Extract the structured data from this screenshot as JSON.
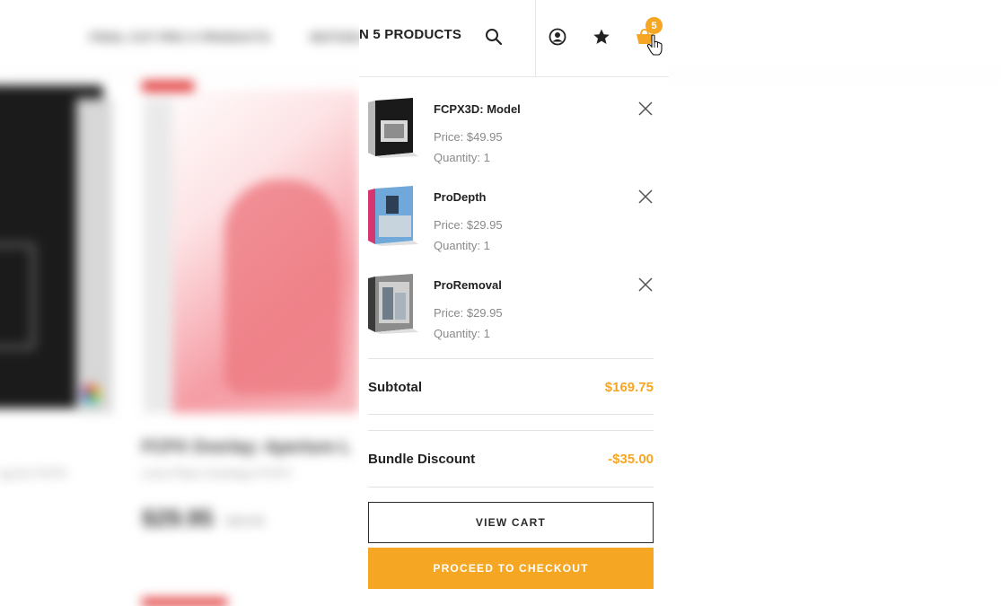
{
  "background": {
    "nav_items": [
      "FINAL CUT PRO X PRODUCTS",
      "MOTION 5 PRODUCTS"
    ],
    "product_title": "FCPX Overlay: Aperture L",
    "product_subtitle": "Lens Flare Overlays FCPX",
    "left_product_subtitle": "ng for FCPX",
    "product_price": "$29.95",
    "product_old_price": "$49.95"
  },
  "header": {
    "nav_visible_label": "N 5 PRODUCTS",
    "icons": [
      "search-icon",
      "account-icon",
      "star-icon",
      "cart-icon"
    ],
    "cart_count": "5"
  },
  "cart": {
    "items": [
      {
        "name": "FCPX3D: Model",
        "price": "Price: $49.95",
        "quantity": "Quantity: 1"
      },
      {
        "name": "ProDepth",
        "price": "Price: $29.95",
        "quantity": "Quantity: 1"
      },
      {
        "name": "ProRemoval",
        "price": "Price: $29.95",
        "quantity": "Quantity: 1"
      }
    ],
    "subtotal_label": "Subtotal",
    "subtotal_value": "$169.75",
    "discount_label": "Bundle Discount",
    "discount_value": "-$35.00",
    "view_cart_label": "VIEW CART",
    "checkout_label": "PROCEED TO CHECKOUT"
  },
  "colors": {
    "accent": "#f5a623",
    "text_dark": "#222222",
    "text_muted": "#8a8a8a"
  }
}
